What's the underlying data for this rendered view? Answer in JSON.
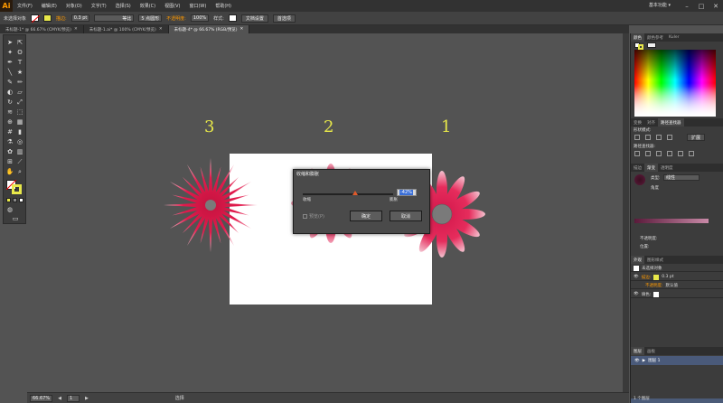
{
  "app": {
    "logo": "Ai",
    "workspace": "基本功能 ▾"
  },
  "menu": [
    "文件(F)",
    "编辑(E)",
    "对象(O)",
    "文字(T)",
    "选择(S)",
    "效果(C)",
    "视图(V)",
    "窗口(W)",
    "帮助(H)"
  ],
  "control_bar": {
    "selection": "未选择对象",
    "stroke_label": "描边:",
    "stroke_value": "0.3 pt",
    "profile": "等比",
    "brush": "5 点圆形",
    "opacity_label": "不透明度:",
    "opacity": "100%",
    "style_label": "样式:",
    "doc_setup": "文档设置",
    "prefs": "首选项"
  },
  "tabs": [
    {
      "label": "未标题-1* @ 66.67% (CMYK/预览)",
      "active": false
    },
    {
      "label": "未标题-1.ai* @ 100% (CMYK/预览)",
      "active": false
    },
    {
      "label": "未标题-4* @ 66.67% (RGB/预览)",
      "active": true
    }
  ],
  "canvas": {
    "labels": [
      "3",
      "2",
      "1"
    ]
  },
  "dialog": {
    "title": "收缩和膨胀",
    "value": "-42%",
    "left_label": "收缩",
    "right_label": "膨胀",
    "preview": "预览(P)",
    "ok": "确定",
    "cancel": "取消",
    "slider_fraction": 0.58
  },
  "status": {
    "zoom": "66.67%",
    "page": "1",
    "mode": "选择"
  },
  "right_panel": {
    "color_tabs": [
      "颜色",
      "颜色参考",
      "Kuler"
    ],
    "pathfinder_tabs": [
      "变换",
      "对齐",
      "路径查找器"
    ],
    "shape_modes": "形状模式:",
    "pathfinders": "路径查找器:",
    "expand": "扩展",
    "gradient_tabs": [
      "描边",
      "渐变",
      "透明度"
    ],
    "gradient_type": "类型:",
    "gradient_type_value": "线性",
    "angle_label": "角度",
    "opacity_label": "不透明度:",
    "location_label": "位置:",
    "appearance_tabs": [
      "外观",
      "图形样式"
    ],
    "appearance_title": "未选择对象",
    "stroke_label": "描边:",
    "stroke_value": "0.3 pt",
    "opacity_label2": "不透明度:",
    "opacity_value": "默认值",
    "fill_label": "填色:",
    "layers_tabs": [
      "图层",
      "画板"
    ],
    "layer_name": "图层 1",
    "layers_count": "1 个图层"
  },
  "colors": {
    "accent": "#ff9a00",
    "flower": "#e21b4d",
    "highlight": "#e8e84a"
  }
}
